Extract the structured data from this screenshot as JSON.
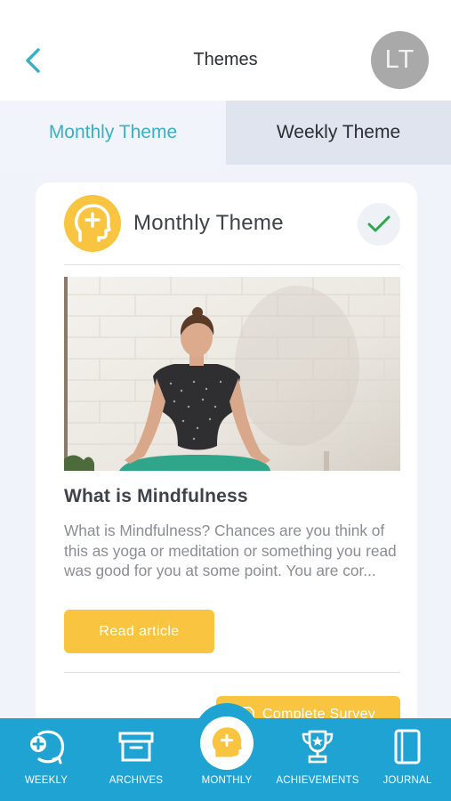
{
  "header": {
    "title": "Themes",
    "avatar_initials": "LT"
  },
  "tabs": [
    {
      "label": "Monthly Theme",
      "active": true
    },
    {
      "label": "Weekly Theme",
      "active": false
    }
  ],
  "card": {
    "title": "Monthly Theme",
    "completed": true,
    "article": {
      "title": "What is Mindfulness",
      "description": "What is Mindfulness?  Chances are you think of this as yoga or meditation or something you read was good for you at some point.  You are cor...",
      "read_button": "Read article"
    },
    "survey_button": "Complete Survey"
  },
  "bottom_nav": [
    {
      "label": "WEEKLY",
      "icon": "weekly-icon"
    },
    {
      "label": "ARCHIVES",
      "icon": "archive-box-icon"
    },
    {
      "label": "MONTHLY",
      "icon": "head-plus-icon",
      "active": true
    },
    {
      "label": "ACHIEVEMENTS",
      "icon": "trophy-icon"
    },
    {
      "label": "JOURNAL",
      "icon": "journal-icon"
    }
  ],
  "colors": {
    "accent_teal": "#3ab0c7",
    "accent_yellow": "#f9c540",
    "nav_blue": "#1fa3d3",
    "check_green": "#2fa84f",
    "background": "#f0f3f9"
  }
}
